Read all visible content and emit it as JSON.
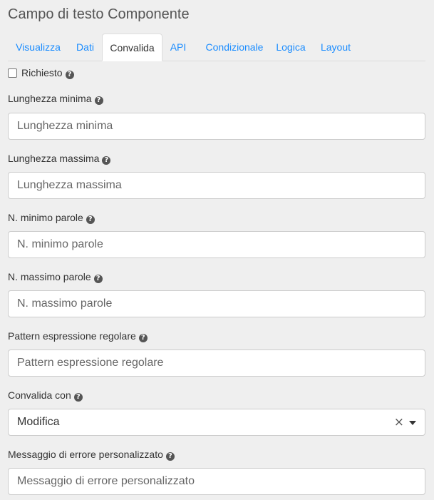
{
  "title": "Campo di testo Componente",
  "tabs": [
    {
      "label": "Visualizza"
    },
    {
      "label": "Dati"
    },
    {
      "label": "Convalida"
    },
    {
      "label": "API"
    },
    {
      "label": "Condizionale"
    },
    {
      "label": "Logica"
    },
    {
      "label": "Layout"
    }
  ],
  "active_tab": "Convalida",
  "help_glyph": "?",
  "required": {
    "label": "Richiesto",
    "checked": false
  },
  "fields": {
    "min_length": {
      "label": "Lunghezza minima",
      "placeholder": "Lunghezza minima"
    },
    "max_length": {
      "label": "Lunghezza massima",
      "placeholder": "Lunghezza massima"
    },
    "min_words": {
      "label": "N. minimo parole",
      "placeholder": "N. minimo parole"
    },
    "max_words": {
      "label": "N. massimo parole",
      "placeholder": "N. massimo parole"
    },
    "pattern": {
      "label": "Pattern espressione regolare",
      "placeholder": "Pattern espressione regolare"
    },
    "validate_on": {
      "label": "Convalida con",
      "value": "Modifica",
      "clear_glyph": "×"
    },
    "custom_message": {
      "label": "Messaggio di errore personalizzato",
      "placeholder": "Messaggio di errore personalizzato"
    }
  },
  "colors": {
    "link": "#1a8cff",
    "background": "#efefef"
  }
}
